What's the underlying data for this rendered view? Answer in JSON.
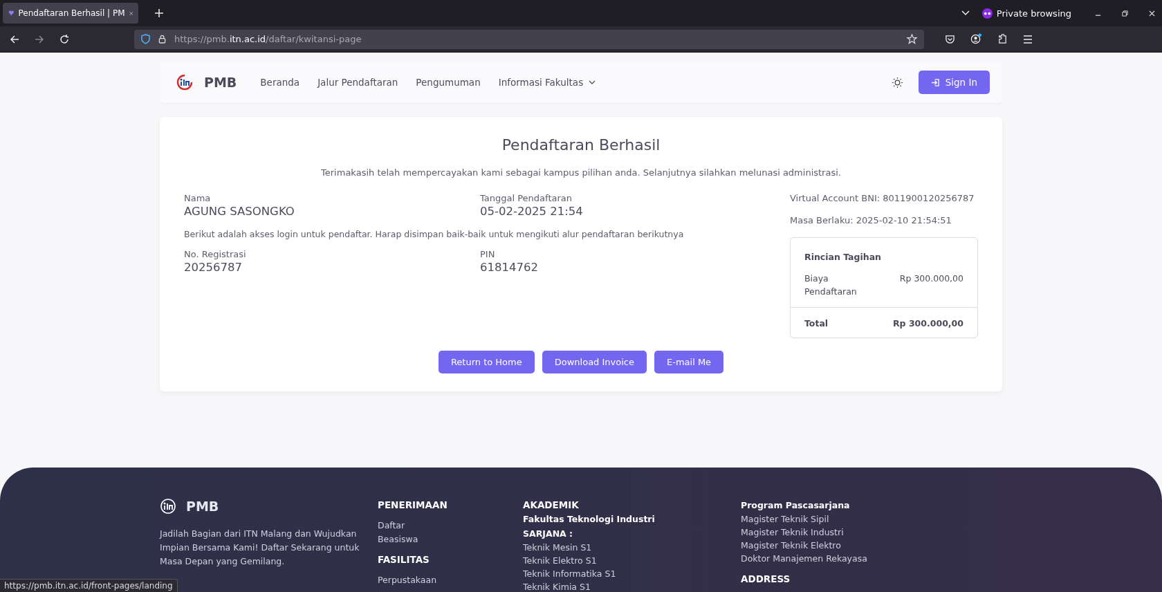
{
  "browser": {
    "tab_title": "Pendaftaran Berhasil | PM",
    "private_label": "Private browsing",
    "url": {
      "prefix": "https://pmb.",
      "domain": "itn.ac.id",
      "path": "/daftar/kwitansi-page"
    },
    "status_url": "https://pmb.itn.ac.id/front-pages/landing"
  },
  "nav": {
    "brand": "PMB",
    "items": [
      {
        "label": "Beranda",
        "dropdown": false
      },
      {
        "label": "Jalur Pendaftaran",
        "dropdown": false
      },
      {
        "label": "Pengumuman",
        "dropdown": false
      },
      {
        "label": "Informasi Fakultas",
        "dropdown": true
      }
    ],
    "sign_in": "Sign In"
  },
  "card": {
    "title": "Pendaftaran Berhasil",
    "subtitle": "Terimakasih telah mempercayakan kami sebagai kampus pilihan anda. Selanjutnya silahkan melunasi administrasi.",
    "fields": [
      {
        "label": "Nama",
        "value": "AGUNG SASONGKO"
      },
      {
        "label": "Tanggal Pendaftaran",
        "value": "05-02-2025 21:54"
      }
    ],
    "note": "Berikut adalah akses login untuk pendaftar. Harap disimpan baik-baik untuk mengikuti alur pendaftaran berikutnya",
    "login_fields": [
      {
        "label": "No. Registrasi",
        "value": "20256787"
      },
      {
        "label": "PIN",
        "value": "61814762"
      }
    ],
    "virtual_account": "Virtual Account BNI: 8011900120256787",
    "valid_until": "Masa Berlaku: 2025-02-10 21:54:51",
    "invoice": {
      "title": "Rincian Tagihan",
      "items": [
        {
          "label": "Biaya Pendaftaran",
          "amount": "Rp 300.000,00"
        }
      ],
      "total_label": "Total",
      "total": "Rp 300.000,00"
    },
    "buttons": [
      "Return to Home",
      "Download Invoice",
      "E-mail Me"
    ]
  },
  "footer": {
    "brand": "PMB",
    "tagline": "Jadilah Bagian dari ITN Malang dan Wujudkan Impian Bersama Kami! Daftar Sekarang untuk Masa Depan yang Gemilang.",
    "columns": [
      [
        {
          "kind": "heading",
          "text": "PENERIMAAN"
        },
        {
          "kind": "gap"
        },
        {
          "kind": "link",
          "text": "Daftar"
        },
        {
          "kind": "link",
          "text": "Beasiswa"
        },
        {
          "kind": "gap"
        },
        {
          "kind": "heading",
          "text": "FASILITAS"
        },
        {
          "kind": "gap"
        },
        {
          "kind": "link",
          "text": "Perpustakaan"
        }
      ],
      [
        {
          "kind": "heading",
          "text": "AKADEMIK"
        },
        {
          "kind": "subheading",
          "text": "Fakultas Teknologi Industri"
        },
        {
          "kind": "subheading",
          "text": "SARJANA :"
        },
        {
          "kind": "link",
          "text": "Teknik Mesin S1"
        },
        {
          "kind": "link",
          "text": "Teknik Elektro S1"
        },
        {
          "kind": "link",
          "text": "Teknik Informatika S1"
        },
        {
          "kind": "link",
          "text": "Teknik Kimia S1"
        }
      ],
      [
        {
          "kind": "subheading",
          "text": "Program Pascasarjana"
        },
        {
          "kind": "link",
          "text": "Magister Teknik Sipil"
        },
        {
          "kind": "link",
          "text": "Magister Teknik Industri"
        },
        {
          "kind": "link",
          "text": "Magister Teknik Elektro"
        },
        {
          "kind": "link",
          "text": "Doktor Manajemen Rekayasa"
        },
        {
          "kind": "gap"
        },
        {
          "kind": "heading",
          "text": "ADDRESS"
        }
      ]
    ]
  }
}
